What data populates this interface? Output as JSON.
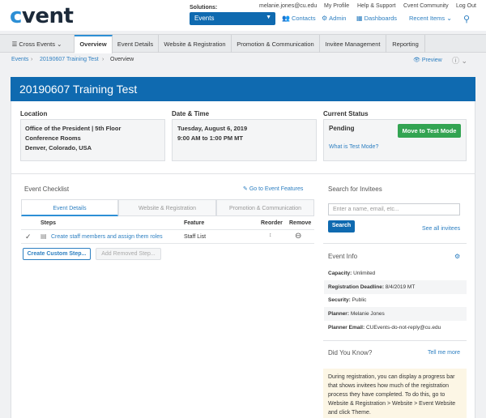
{
  "header": {
    "logo_c": "c",
    "logo_rest": "vent",
    "solutions_label": "Solutions:",
    "solutions_value": "Events",
    "user_email": "melanie.jones@cu.edu",
    "my_profile": "My Profile",
    "help_support": "Help & Support",
    "community": "Cvent Community",
    "logout": "Log Out",
    "contacts": "Contacts",
    "admin": "Admin",
    "dashboards": "Dashboards",
    "recent_items": "Recent Items"
  },
  "tabs": [
    "Cross Events",
    "Overview",
    "Event Details",
    "Website & Registration",
    "Promotion & Communication",
    "Invitee Management",
    "Reporting"
  ],
  "breadcrumb": {
    "events": "Events",
    "event": "20190607 Training Test",
    "current": "Overview",
    "preview": "Preview"
  },
  "event": {
    "title": "20190607 Training Test"
  },
  "location": {
    "label": "Location",
    "line1": "Office of the President | 5th Floor",
    "line2": "Conference Rooms",
    "line3": "Denver, Colorado, USA"
  },
  "datetime": {
    "label": "Date & Time",
    "date": "Tuesday, August 6, 2019",
    "time": "9:00 AM to 1:00 PM MT"
  },
  "status": {
    "label": "Current Status",
    "value": "Pending",
    "button": "Move to Test Mode",
    "link": "What is Test Mode?"
  },
  "checklist": {
    "title": "Event Checklist",
    "go_link": "Go to Event Features",
    "tabs": [
      "Event Details",
      "Website & Registration",
      "Promotion & Communication"
    ],
    "headers": {
      "steps": "Steps",
      "feature": "Feature",
      "reorder": "Reorder",
      "remove": "Remove"
    },
    "rows": [
      {
        "step": "Create staff members and assign them roles",
        "feature": "Staff List"
      }
    ],
    "create_button": "Create Custom Step...",
    "add_removed_button": "Add Removed Step..."
  },
  "search": {
    "title": "Search for Invitees",
    "placeholder": "Enter a name, email, etc...",
    "button": "Search",
    "see_all": "See all invitees"
  },
  "event_info": {
    "title": "Event Info",
    "rows": [
      {
        "label": "Capacity:",
        "value": "Unlimited"
      },
      {
        "label": "Registration Deadline:",
        "value": "8/4/2019 MT"
      },
      {
        "label": "Security:",
        "value": "Public"
      },
      {
        "label": "Planner:",
        "value": "Melanie Jones"
      },
      {
        "label": "Planner Email:",
        "value": "CUEvents-do-not-reply@cu.edu"
      }
    ]
  },
  "did_you_know": {
    "title": "Did You Know?",
    "tell_more": "Tell me more",
    "text": "During registration, you can display a progress bar that shows invitees how much of the registration process they have completed. To do this, go to Website & Registration > Website > Event Website and click Theme."
  },
  "colors": {
    "brand_blue": "#0f6ab0",
    "link_blue": "#2d7fc1",
    "green": "#33a452"
  }
}
